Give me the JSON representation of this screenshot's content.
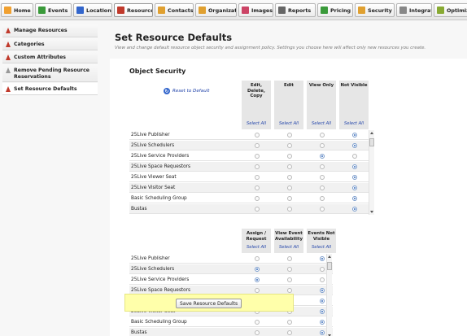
{
  "topbar": {
    "tabs": [
      {
        "label": "Home",
        "icon": "home-icon",
        "color": "#f0a030"
      },
      {
        "label": "Events",
        "icon": "events-icon",
        "color": "#3a9a3a"
      },
      {
        "label": "Locations",
        "icon": "locations-icon",
        "color": "#3366cc"
      },
      {
        "label": "Resources",
        "icon": "resources-icon",
        "color": "#c0392b",
        "active": true
      },
      {
        "label": "Contacts",
        "icon": "contacts-icon",
        "color": "#e0a030"
      },
      {
        "label": "Organizati",
        "icon": "organizations-icon",
        "color": "#e0a030"
      },
      {
        "label": "Images",
        "icon": "images-icon",
        "color": "#cc4466"
      },
      {
        "label": "Reports",
        "icon": "reports-icon",
        "color": "#666666"
      },
      {
        "label": "Pricing",
        "icon": "pricing-icon",
        "color": "#3a9a3a"
      },
      {
        "label": "Security",
        "icon": "security-icon",
        "color": "#e0a030"
      },
      {
        "label": "Integratio",
        "icon": "integration-icon",
        "color": "#888888"
      },
      {
        "label": "Optimizer",
        "icon": "optimizer-icon",
        "color": "#88aa33"
      }
    ]
  },
  "sidebar": {
    "items": [
      {
        "label": "Manage Resources"
      },
      {
        "label": "Categories"
      },
      {
        "label": "Custom Attributes"
      },
      {
        "label": "Remove Pending Resource Reservations"
      },
      {
        "label": "Set Resource Defaults",
        "active": true
      }
    ]
  },
  "main": {
    "title": "Set Resource Defaults",
    "description": "View and change default resource object security and assignment policy. Settings you choose here will affect only new resources you create."
  },
  "security": {
    "section_title": "Object Security",
    "reset_label": "Reset to Default",
    "columns": [
      {
        "label": "Edit, Delete, Copy",
        "select_all": "Select All"
      },
      {
        "label": "Edit",
        "select_all": "Select All"
      },
      {
        "label": "View Only",
        "select_all": "Select All"
      },
      {
        "label": "Not Visible",
        "select_all": "Select All"
      }
    ],
    "rows": [
      {
        "name": "25Live Publisher",
        "selected": 3
      },
      {
        "name": "25Live Schedulers",
        "selected": 3
      },
      {
        "name": "25Live Service Providers",
        "selected": 2
      },
      {
        "name": "25Live Space Requestors",
        "selected": 3
      },
      {
        "name": "25Live Viewer Seat",
        "selected": 3
      },
      {
        "name": "25Live Visitor Seat",
        "selected": 3
      },
      {
        "name": "Basic Scheduling Group",
        "selected": 3
      },
      {
        "name": "Bustas",
        "selected": 3
      }
    ]
  },
  "assignment": {
    "columns": [
      {
        "label": "Assign / Request",
        "select_all": "Select All"
      },
      {
        "label": "View Event Availability",
        "select_all": "Select All"
      },
      {
        "label": "Events Not Visible",
        "select_all": "Select All"
      }
    ],
    "rows": [
      {
        "name": "25Live Publisher",
        "selected": 2
      },
      {
        "name": "25Live Schedulers",
        "selected": 0
      },
      {
        "name": "25Live Service Providers",
        "selected": 0
      },
      {
        "name": "25Live Space Requestors",
        "selected": 2
      },
      {
        "name": "25Live Viewer Seat",
        "selected": 2
      },
      {
        "name": "25Live Visitor Seat",
        "selected": 2
      },
      {
        "name": "Basic Scheduling Group",
        "selected": 2
      },
      {
        "name": "Bustas",
        "selected": 2
      }
    ]
  },
  "footer": {
    "save_label": "Save Resource Defaults"
  }
}
